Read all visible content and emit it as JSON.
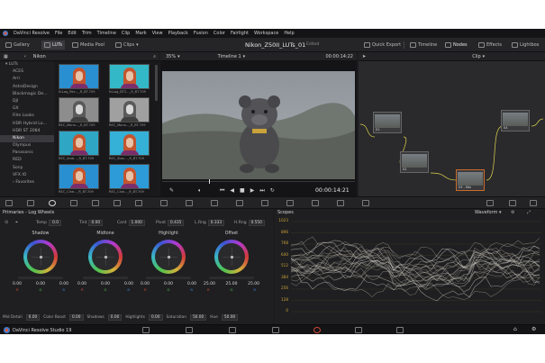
{
  "app": {
    "menu": [
      "DaVinci Resolve",
      "File",
      "Edit",
      "Trim",
      "Timeline",
      "Clip",
      "Mark",
      "View",
      "Playback",
      "Fusion",
      "Color",
      "Fairlight",
      "Workspace",
      "Help"
    ],
    "project_title": "Nikon_Z50II_LUTs_01",
    "project_status": "Edited",
    "footer_name": "DaVinci Resolve Studio 19"
  },
  "toolbar": {
    "gallery": "Gallery",
    "luts": "LUTs",
    "media_pool": "Media Pool",
    "clips": "Clips",
    "quick_export": "Quick Export",
    "timeline": "Timeline",
    "nodes": "Nodes",
    "effects": "Effects",
    "lightbox": "Lightbox"
  },
  "subbar": {
    "lut_folder": "Nikon",
    "zoom": "35%",
    "timeline_name": "Timeline 1",
    "timecode": "00:00:14:22",
    "node_mode": "Clip"
  },
  "lut_list": {
    "items": [
      "LUTs",
      "ACES",
      "Arri",
      "AstroDesign",
      "Blackmagic De...",
      "DJI",
      "GX",
      "Film Looks",
      "HDR Hybrid Lo...",
      "HDR ST 2084",
      "Nikon",
      "Olympus",
      "Panasonic",
      "RED",
      "Sony",
      "VFX IO",
      "Favorites"
    ],
    "selected_index": 10
  },
  "thumbnails": [
    {
      "caption": "N-Log_Rec..._R_BT.709",
      "color": "#2a8fd0",
      "tone": "color"
    },
    {
      "caption": "N-Log_BT2..._R_BT.709",
      "color": "#33b8c8",
      "tone": "color"
    },
    {
      "caption": "REC_Mono..._R_BT.709",
      "color": "#8d8d8d",
      "tone": "mono"
    },
    {
      "caption": "REC_Mono..._R_BT.709",
      "color": "#a0a0a0",
      "tone": "mono"
    },
    {
      "caption": "REC_Amb..._R_BT.709",
      "color": "#2fa6c4",
      "tone": "color"
    },
    {
      "caption": "REC_Stan..._R_BT.709",
      "color": "#35b0d6",
      "tone": "color"
    },
    {
      "caption": "REC_Cine..._R_BT.709",
      "color": "#2a8fd0",
      "tone": "color"
    },
    {
      "caption": "REC_Cine..._R_BT.709",
      "color": "#2d9bd8",
      "tone": "color"
    }
  ],
  "viewer": {
    "timecode": "00:00:14:21"
  },
  "nodes": [
    {
      "label": "01"
    },
    {
      "label": "02"
    },
    {
      "label": "03 - Mix"
    },
    {
      "label": "04"
    }
  ],
  "primaries": {
    "title": "Primaries - Log Wheels",
    "params_top": [
      {
        "label": "Temp",
        "value": "0.0"
      },
      {
        "label": "Tint",
        "value": "0.00"
      },
      {
        "label": "Cont",
        "value": "1.000"
      },
      {
        "label": "Pivot",
        "value": "0.435"
      },
      {
        "label": "L.Rng",
        "value": "0.333"
      },
      {
        "label": "H.Rng",
        "value": "0.550"
      }
    ],
    "wheels": [
      {
        "title": "Shadow",
        "values": [
          "0.00",
          "0.00",
          "0.00"
        ]
      },
      {
        "title": "Midtone",
        "values": [
          "0.00",
          "0.00",
          "0.00"
        ]
      },
      {
        "title": "Highlight",
        "values": [
          "0.00",
          "0.00",
          "0.00"
        ]
      },
      {
        "title": "Offset",
        "values": [
          "25.00",
          "25.00",
          "25.00"
        ]
      }
    ],
    "params_bottom": [
      {
        "label": "Mid Detail",
        "value": "0.00"
      },
      {
        "label": "Color Boost",
        "value": "0.00"
      },
      {
        "label": "Shadows",
        "value": "0.00"
      },
      {
        "label": "Highlights",
        "value": "0.00"
      },
      {
        "label": "Saturation",
        "value": "50.00"
      },
      {
        "label": "Hue",
        "value": "50.00"
      }
    ]
  },
  "scopes": {
    "title": "Scopes",
    "mode": "Waveform",
    "axis_labels": [
      "1023",
      "896",
      "768",
      "640",
      "512",
      "384",
      "256",
      "128",
      "0"
    ]
  },
  "colors": {
    "accent_red": "#d34a3a",
    "panel_bg": "#1f1f21",
    "node_link": "#e0d34a"
  }
}
